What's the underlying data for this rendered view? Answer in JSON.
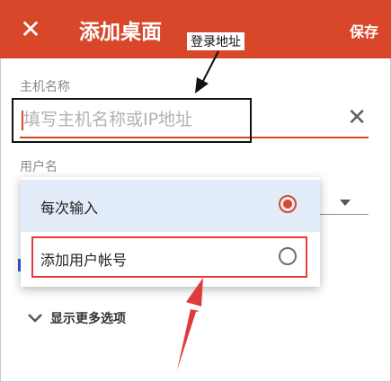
{
  "header": {
    "title": "添加桌面",
    "save_label": "保存",
    "close_icon": "close-icon"
  },
  "annotation": {
    "login_address": "登录地址"
  },
  "host_field": {
    "label": "主机名称",
    "placeholder": "填写主机名称或IP地址",
    "value": "",
    "clear_icon": "clear-icon"
  },
  "user_field": {
    "label": "用户名"
  },
  "user_menu": {
    "items": [
      {
        "label": "每次输入",
        "selected": true
      },
      {
        "label": "添加用户帐号",
        "selected": false
      }
    ]
  },
  "more_options": {
    "label": "显示更多选项",
    "icon": "chevron-down-icon"
  },
  "colors": {
    "accent": "#d9472b",
    "selected_bg": "#e3ecf9",
    "highlight_red": "#e63b3b"
  }
}
